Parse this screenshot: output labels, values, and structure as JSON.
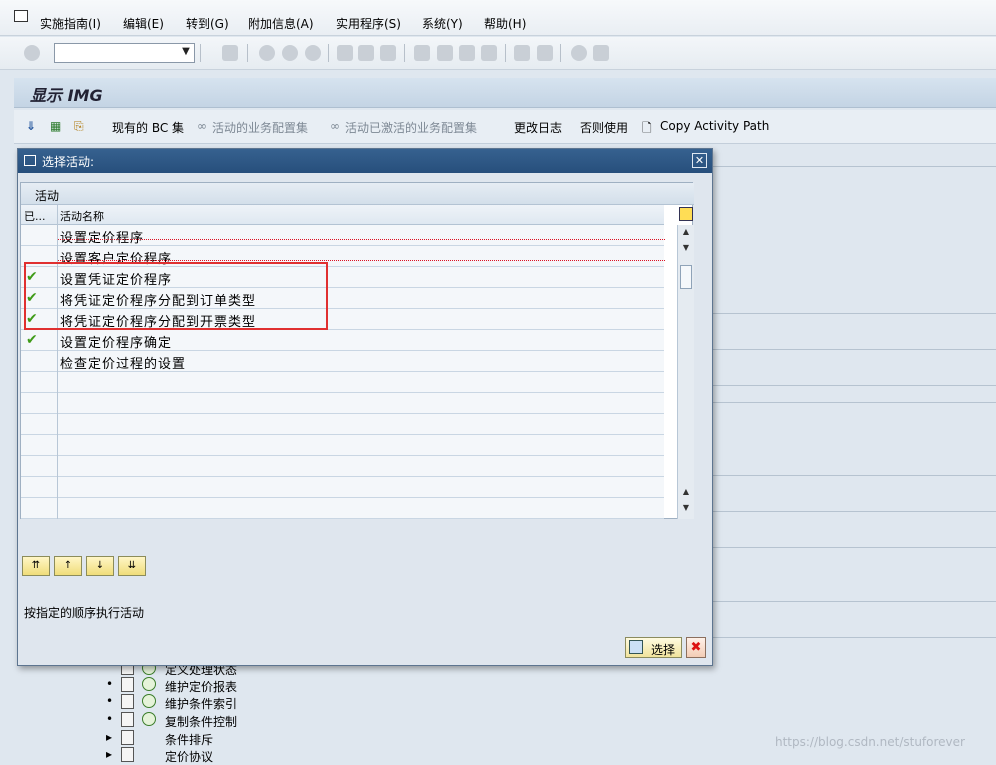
{
  "menu": [
    "实施指南(I)",
    "编辑(E)",
    "转到(G)",
    "附加信息(A)",
    "实用程序(S)",
    "系统(Y)",
    "帮助(H)"
  ],
  "page_title": "显示 IMG",
  "app_toolbar": {
    "existing_bc": "现有的 BC 集",
    "active_bc": "活动的业务配置集",
    "activated_bc": "活动已激活的业务配置集",
    "change_log": "更改日志",
    "usage": "否则使用",
    "copy_path": "Copy Activity Path"
  },
  "dialog": {
    "title": "选择活动:",
    "table_caption": "活动",
    "col_status": "已...",
    "col_name": "活动名称",
    "rows": [
      {
        "done": false,
        "name": "设置定价程序"
      },
      {
        "done": false,
        "name": "设置客户定价程序"
      },
      {
        "done": true,
        "name": "设置凭证定价程序"
      },
      {
        "done": true,
        "name": "将凭证定价程序分配到订单类型"
      },
      {
        "done": true,
        "name": "将凭证定价程序分配到开票类型"
      },
      {
        "done": true,
        "name": "设置定价程序确定"
      },
      {
        "done": false,
        "name": "检查定价过程的设置"
      }
    ],
    "hint": "按指定的顺序执行活动",
    "select_label": "选择",
    "cancel_label": "✖"
  },
  "tree": [
    {
      "label": "定义处理状态"
    },
    {
      "label": "维护定价报表"
    },
    {
      "label": "维护条件索引"
    },
    {
      "label": "复制条件控制"
    },
    {
      "label": "条件排斥"
    },
    {
      "label": "定价协议"
    }
  ],
  "watermark": "https://blog.csdn.net/stuforever",
  "colors": {
    "accent": "#274f7c",
    "check": "#3f9b18",
    "highlight": "#e03030"
  }
}
